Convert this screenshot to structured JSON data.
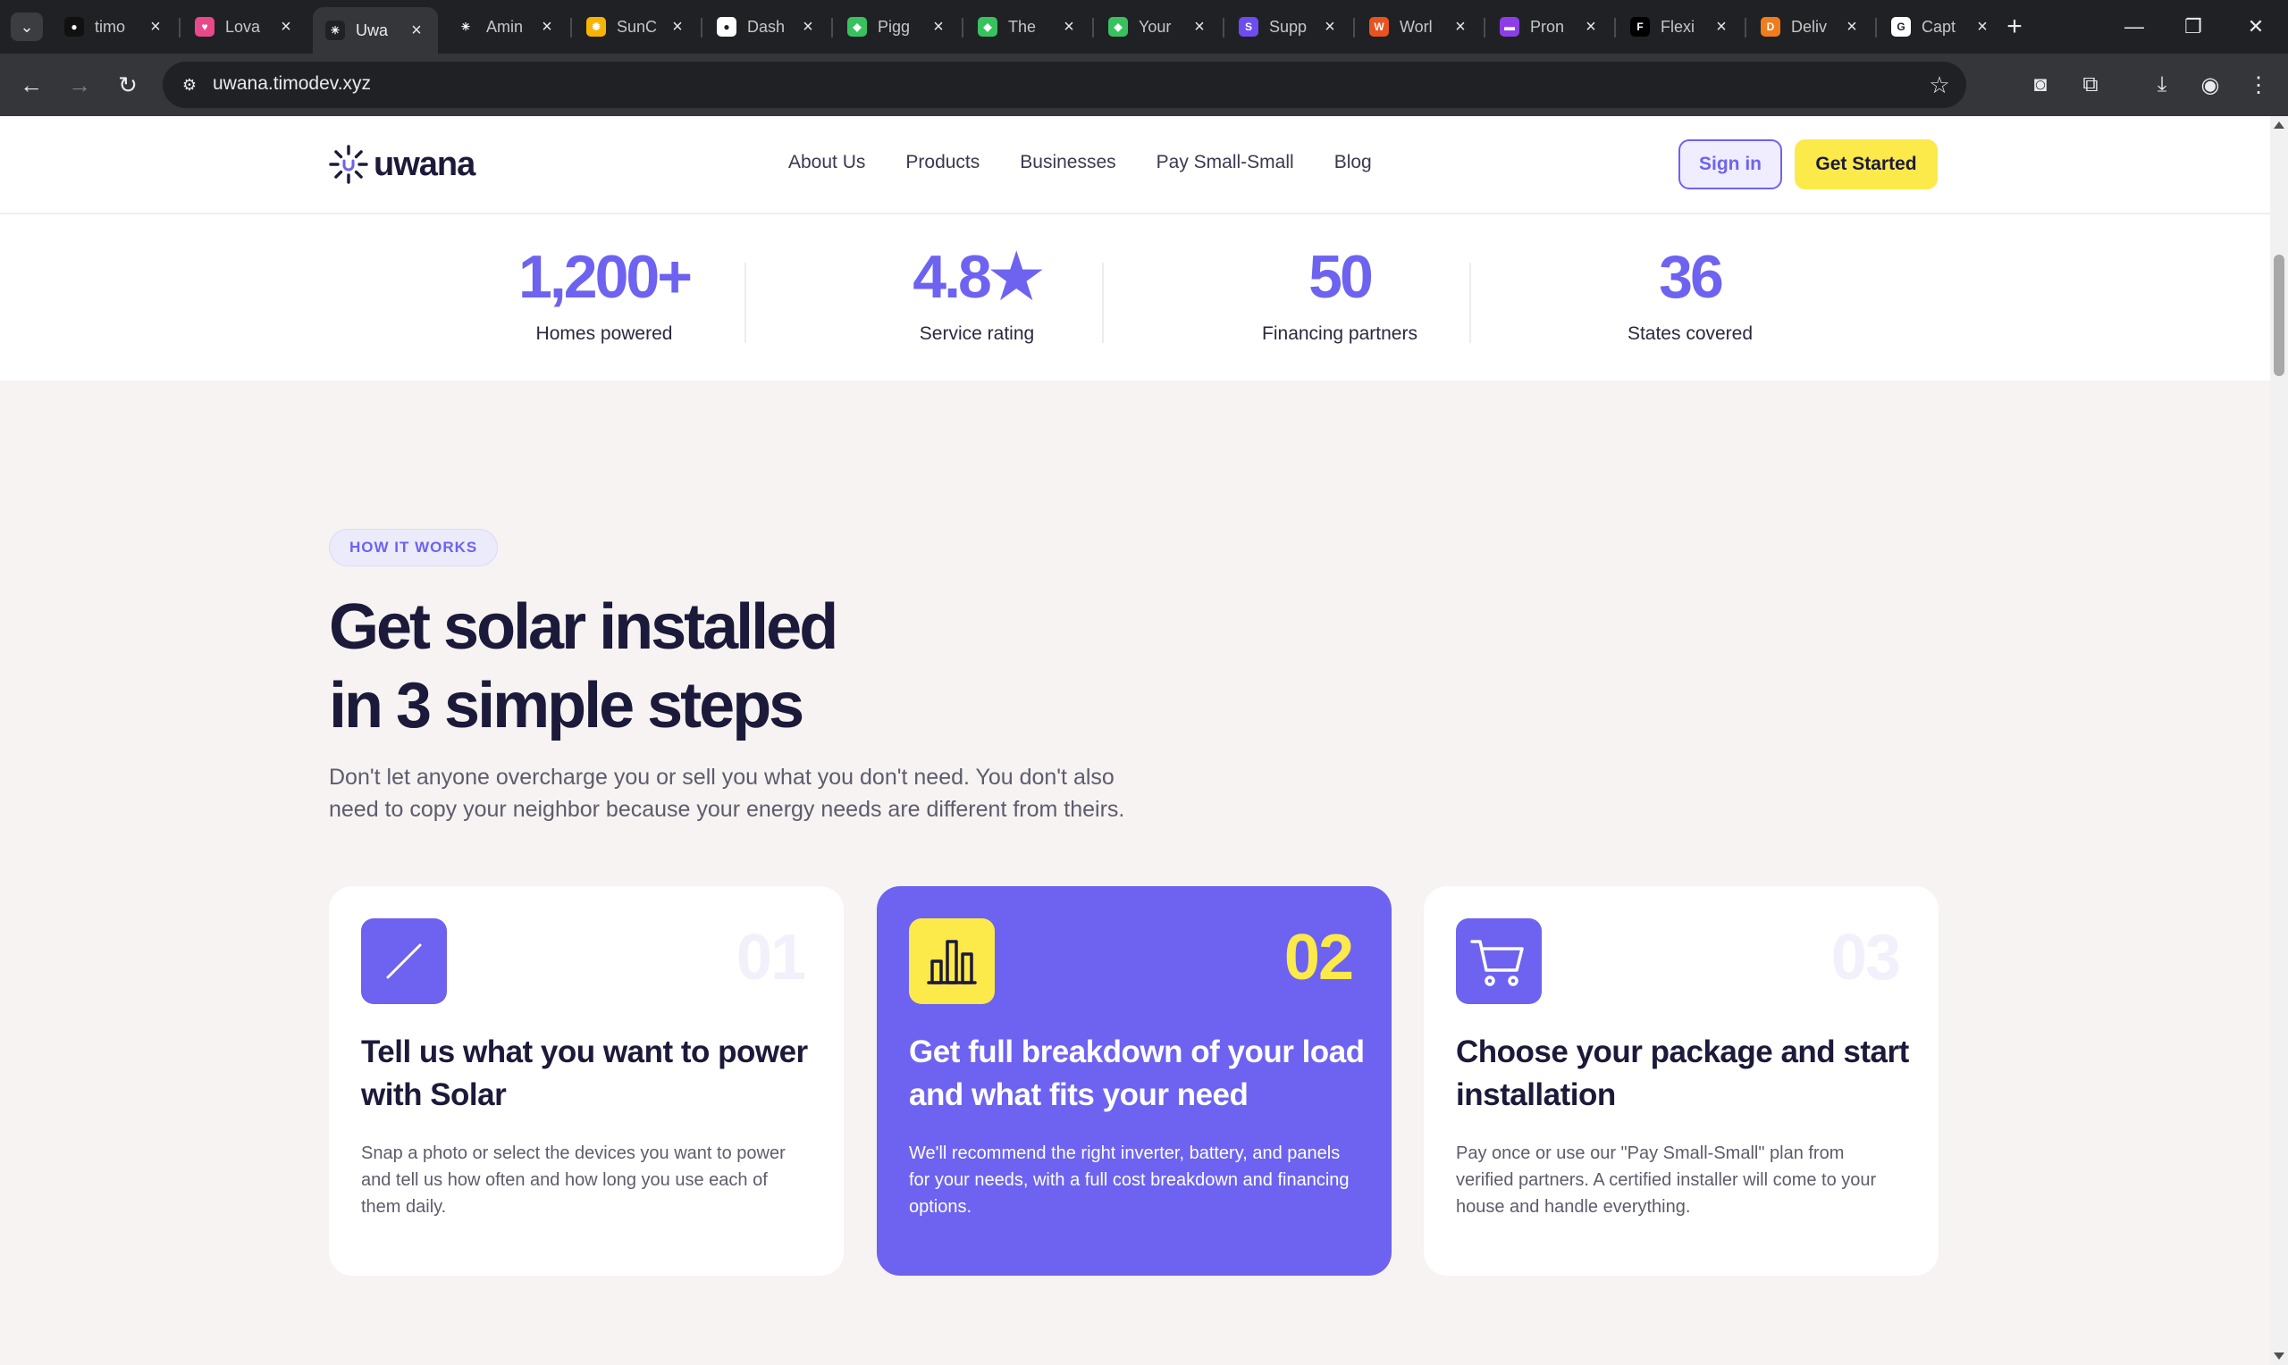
{
  "browser": {
    "tabs": [
      {
        "title": "timo",
        "favicon_color": "#111111",
        "favicon_glyph": "●",
        "active": false
      },
      {
        "title": "Lova",
        "favicon_color": "#e9488b",
        "favicon_glyph": "♥",
        "active": false
      },
      {
        "title": "Uwa",
        "favicon_color": "#202124",
        "favicon_glyph": "✳",
        "active": true
      },
      {
        "title": "Amin",
        "favicon_color": "#202124",
        "favicon_glyph": "✳",
        "active": false
      },
      {
        "title": "SunC",
        "favicon_color": "#f6b400",
        "favicon_glyph": "✹",
        "active": false
      },
      {
        "title": "Dash",
        "favicon_color": "#ffffff",
        "favicon_glyph": "●",
        "active": false
      },
      {
        "title": "Pigg",
        "favicon_color": "#38c25f",
        "favicon_glyph": "◆",
        "active": false
      },
      {
        "title": "The",
        "favicon_color": "#38c25f",
        "favicon_glyph": "◆",
        "active": false
      },
      {
        "title": "Your",
        "favicon_color": "#38c25f",
        "favicon_glyph": "◆",
        "active": false
      },
      {
        "title": "Supp",
        "favicon_color": "#6d4df0",
        "favicon_glyph": "S",
        "active": false
      },
      {
        "title": "Worl",
        "favicon_color": "#e8531f",
        "favicon_glyph": "W",
        "active": false
      },
      {
        "title": "Pron",
        "favicon_color": "#8e3ee8",
        "favicon_glyph": "▬",
        "active": false
      },
      {
        "title": "Flexi",
        "favicon_color": "#000000",
        "favicon_glyph": "F",
        "active": false
      },
      {
        "title": "Deliv",
        "favicon_color": "#f07c1e",
        "favicon_glyph": "D",
        "active": false
      },
      {
        "title": "Capt",
        "favicon_color": "#ffffff",
        "favicon_glyph": "G",
        "active": false
      }
    ],
    "url": "uwana.timodev.xyz",
    "new_tab_icon": "+",
    "window_controls": {
      "minimize": "—",
      "restore": "❐",
      "close": "✕"
    }
  },
  "site": {
    "logo_text": "uwana",
    "nav": [
      "About Us",
      "Products",
      "Businesses",
      "Pay Small-Small",
      "Blog"
    ],
    "signin_label": "Sign in",
    "get_started_label": "Get Started",
    "accent_color": "#6d63f0",
    "highlight_color": "#fce94a"
  },
  "stats": [
    {
      "value": "1,200+",
      "label": "Homes powered"
    },
    {
      "value": "4.8★",
      "label": "Service rating"
    },
    {
      "value": "50",
      "label": "Financing partners"
    },
    {
      "value": "36",
      "label": "States covered"
    }
  ],
  "how_it_works": {
    "badge": "HOW IT WORKS",
    "headline_line1": "Get solar installed",
    "headline_line2": "in 3 simple steps",
    "intro_line1": "Don't let anyone overcharge you or sell you what you don't need. You don't also",
    "intro_line2": "need to copy your neighbor because your energy needs are different from theirs.",
    "steps": [
      {
        "number": "01",
        "icon": "slash-icon",
        "title": "Tell us what you want to power with Solar",
        "description": "Snap a photo or select the devices you want to power and tell us how often and how long you use each of them daily."
      },
      {
        "number": "02",
        "icon": "bar-chart-icon",
        "title": "Get full breakdown of your load and what fits your need",
        "description": "We'll recommend the right inverter, battery, and panels for your needs, with a full cost breakdown and financing options."
      },
      {
        "number": "03",
        "icon": "cart-icon",
        "title": "Choose your package and start installation",
        "description": "Pay once or use our \"Pay Small-Small\" plan from verified partners. A certified installer will come to your house and handle everything."
      }
    ]
  }
}
